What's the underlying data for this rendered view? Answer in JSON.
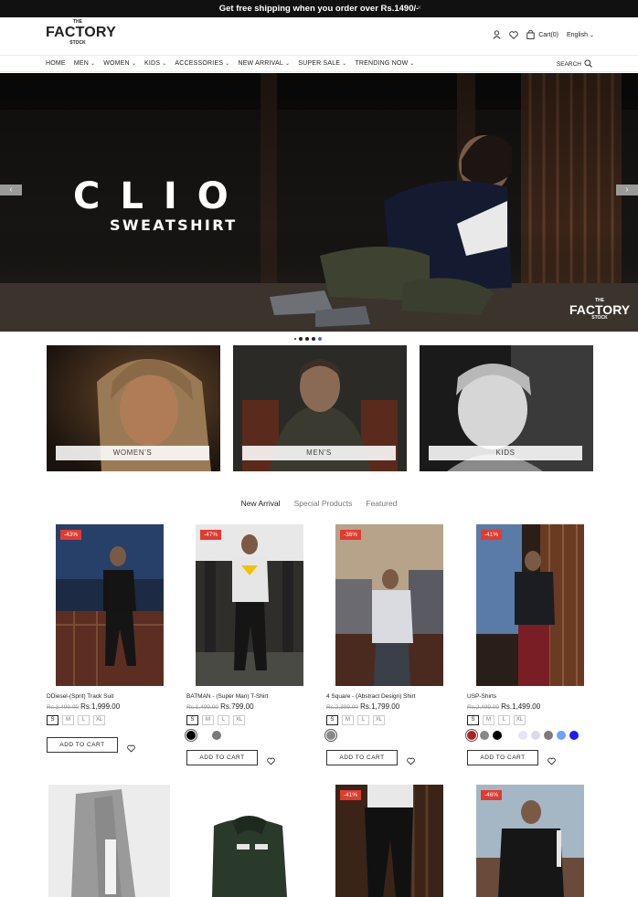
{
  "announcement": {
    "text": "Get free shipping when you order over Rs.1490/-",
    "close": "×"
  },
  "logo": {
    "the": "THE",
    "name": "FACTORY",
    "stock": "STOCK"
  },
  "header": {
    "cart_label": "Cart(0)",
    "language": "English",
    "icons": [
      "user-icon",
      "heart-icon",
      "bag-icon"
    ]
  },
  "nav": {
    "items": [
      {
        "label": "HOME",
        "has_menu": false
      },
      {
        "label": "MEN",
        "has_menu": true
      },
      {
        "label": "WOMEN",
        "has_menu": true
      },
      {
        "label": "KIDS",
        "has_menu": true
      },
      {
        "label": "ACCESSORIES",
        "has_menu": true
      },
      {
        "label": "NEW ARRIVAL",
        "has_menu": true
      },
      {
        "label": "SUPER SALE",
        "has_menu": true
      },
      {
        "label": "TRENDING NOW",
        "has_menu": true
      }
    ],
    "search_label": "SEARCH"
  },
  "hero": {
    "title": "CLIO",
    "subtitle": "SWEATSHIRT",
    "prev": "‹",
    "next": "›",
    "logo": {
      "the": "THE",
      "name": "FACTORY",
      "stock": "STOCK"
    },
    "slides_count": 5,
    "active_slide": 4
  },
  "categories": [
    {
      "label": "WOMEN'S"
    },
    {
      "label": "MEN'S"
    },
    {
      "label": "KIDS"
    }
  ],
  "tabs": [
    {
      "label": "New Arrival",
      "active": true
    },
    {
      "label": "Special Products",
      "active": false
    },
    {
      "label": "Featured",
      "active": false
    }
  ],
  "products": [
    {
      "badge": "-43%",
      "name": "DDiesel-(Sprit) Track Suit",
      "old_price": "Rs.3,499.00",
      "price": "Rs.1,999.00",
      "sizes": [
        "S",
        "M",
        "L",
        "XL"
      ],
      "selected_size": "S",
      "colors": [],
      "button": "ADD TO CART"
    },
    {
      "badge": "-47%",
      "name": "BATMAN - (Super Man) T-Shirt",
      "old_price": "Rs.1,499.00",
      "price": "Rs.799.00",
      "sizes": [
        "S",
        "M",
        "L",
        "XL"
      ],
      "selected_size": "S",
      "colors": [
        "#000000",
        "#ffffff",
        "#7a7a7a"
      ],
      "button": "ADD TO CART"
    },
    {
      "badge": "-36%",
      "name": "4 Square - (Abstract Design) Shirt",
      "old_price": "Rs.2,399.00",
      "price": "Rs.1,799.00",
      "sizes": [
        "S",
        "M",
        "L",
        "XL"
      ],
      "selected_size": "S",
      "colors": [
        "#8a8a8a"
      ],
      "button": "ADD TO CART"
    },
    {
      "badge": "-41%",
      "name": "USP-Shirts",
      "old_price": "Rs.2,499.00",
      "price": "Rs.1,499.00",
      "sizes": [
        "S",
        "M",
        "L",
        "XL"
      ],
      "selected_size": "S",
      "colors": [
        "#b22222",
        "#888888",
        "#000000",
        "#ffffff",
        "#e4e4f2",
        "#dcdce8",
        "#7b7b7b",
        "#6ea3ff",
        "#1a1aff"
      ],
      "button": "ADD TO CART"
    }
  ],
  "products_row2": [
    {
      "badge": ""
    },
    {
      "badge": ""
    },
    {
      "badge": "-41%"
    },
    {
      "badge": "-46%"
    }
  ]
}
